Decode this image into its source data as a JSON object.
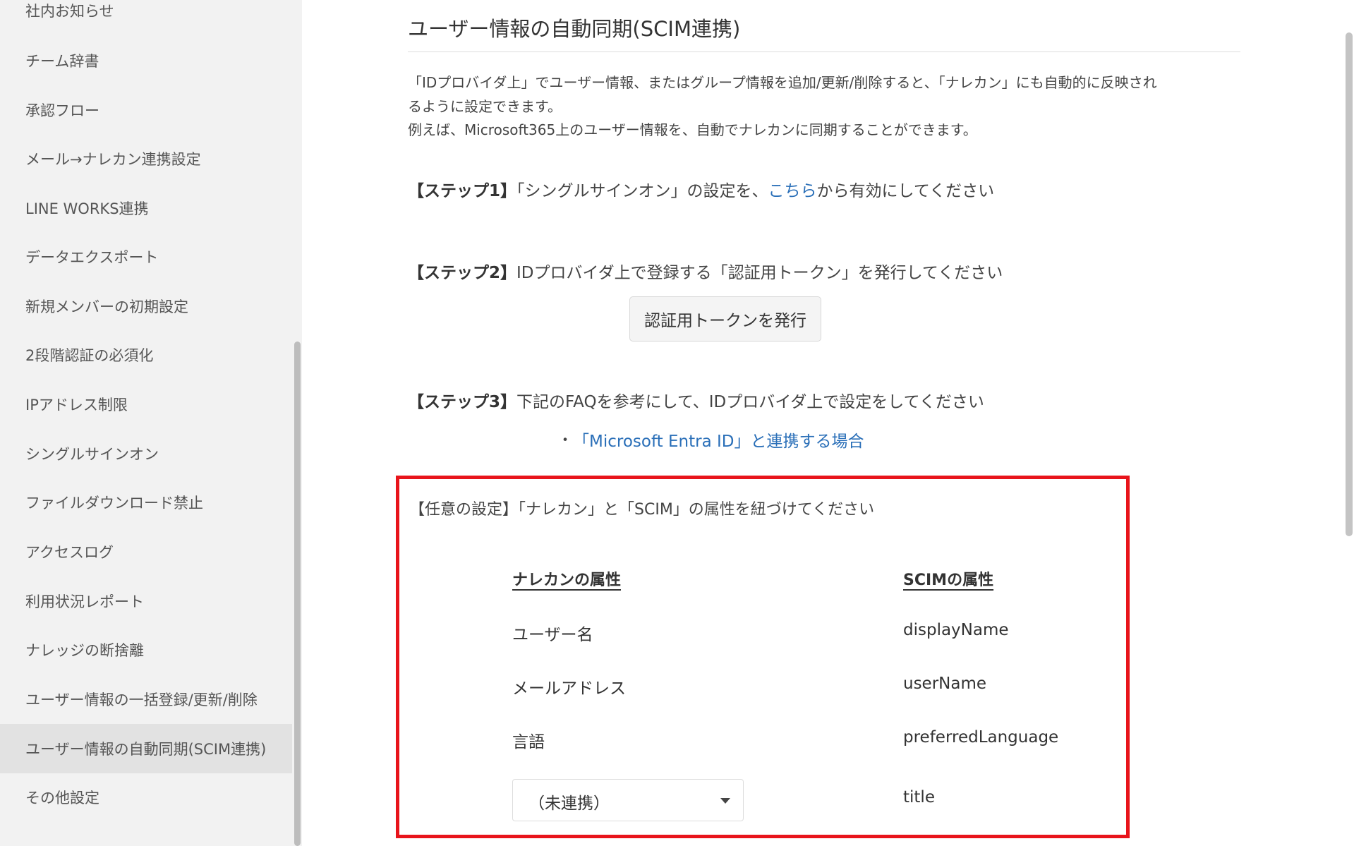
{
  "sidebar": {
    "items": [
      {
        "label": "社内お知らせ"
      },
      {
        "label": "チーム辞書"
      },
      {
        "label": "承認フロー"
      },
      {
        "label": "メール→ナレカン連携設定"
      },
      {
        "label": "LINE WORKS連携"
      },
      {
        "label": "データエクスポート"
      },
      {
        "label": "新規メンバーの初期設定"
      },
      {
        "label": "2段階認証の必須化"
      },
      {
        "label": "IPアドレス制限"
      },
      {
        "label": "シングルサインオン"
      },
      {
        "label": "ファイルダウンロード禁止"
      },
      {
        "label": "アクセスログ"
      },
      {
        "label": "利用状況レポート"
      },
      {
        "label": "ナレッジの断捨離"
      },
      {
        "label": "ユーザー情報の一括登録/更新/削除"
      },
      {
        "label": "ユーザー情報の自動同期(SCIM連携)",
        "active": true
      },
      {
        "label": "その他設定"
      }
    ]
  },
  "main": {
    "title": "ユーザー情報の自動同期(SCIM連携)",
    "description": {
      "line1": "「IDプロバイダ上」でユーザー情報、またはグループ情報を追加/更新/削除すると、「ナレカン」にも自動的に反映され",
      "line2": "るように設定できます。",
      "line3": "例えば、Microsoft365上のユーザー情報を、自動でナレカンに同期することができます。"
    },
    "step1": {
      "label": "【ステップ1】",
      "text_before": "「シングルサインオン」の設定を、",
      "link": "こちら",
      "text_after": "から有効にしてください"
    },
    "step2": {
      "label": "【ステップ2】",
      "text": "IDプロバイダ上で登録する「認証用トークン」を発行してください",
      "button_label": "認証用トークンを発行"
    },
    "step3": {
      "label": "【ステップ3】",
      "text": "下記のFAQを参考にして、IDプロバイダ上で設定をしてください",
      "bullet": "・",
      "faq_link": "「Microsoft Entra ID」と連携する場合"
    },
    "optional": {
      "title": "【任意の設定】「ナレカン」と「SCIM」の属性を紐づけてください",
      "col_narekan": "ナレカンの属性",
      "col_scim": "SCIMの属性",
      "rows": [
        {
          "narekan": "ユーザー名",
          "scim": "displayName"
        },
        {
          "narekan": "メールアドレス",
          "scim": "userName"
        },
        {
          "narekan": "言語",
          "scim": "preferredLanguage"
        }
      ],
      "select_row": {
        "selected": "（未連携）",
        "scim": "title"
      }
    }
  },
  "colors": {
    "highlight_border": "#e8141b",
    "link": "#2a6fb8",
    "sidebar_bg": "#f2f2f2",
    "sidebar_active_bg": "#e2e2e2"
  }
}
